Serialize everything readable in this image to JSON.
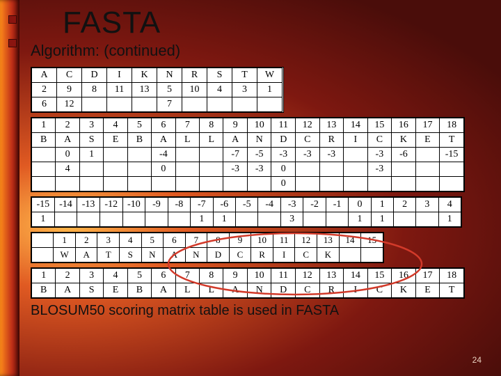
{
  "slide": {
    "title": "FASTA",
    "subtitle": "Algorithm: (continued)",
    "footnote": "BLOSUM50 scoring matrix table is used in FASTA",
    "page_number": "24"
  },
  "tables": {
    "t1": [
      [
        "A",
        "C",
        "D",
        "I",
        "K",
        "N",
        "R",
        "S",
        "T",
        "W"
      ],
      [
        "2",
        "9",
        "8",
        "11",
        "13",
        "5",
        "10",
        "4",
        "3",
        "1"
      ],
      [
        "6",
        "12",
        "",
        "",
        "",
        "7",
        "",
        "",
        "",
        ""
      ]
    ],
    "t2": [
      [
        "1",
        "2",
        "3",
        "4",
        "5",
        "6",
        "7",
        "8",
        "9",
        "10",
        "11",
        "12",
        "13",
        "14",
        "15",
        "16",
        "17",
        "18"
      ],
      [
        "B",
        "A",
        "S",
        "E",
        "B",
        "A",
        "L",
        "L",
        "A",
        "N",
        "D",
        "C",
        "R",
        "I",
        "C",
        "K",
        "E",
        "T"
      ],
      [
        "",
        "0",
        "1",
        "",
        "",
        "-4",
        "",
        "",
        "-7",
        "-5",
        "-3",
        "-3",
        "-3",
        "",
        "-3",
        "-6",
        "",
        "-15"
      ],
      [
        "",
        "4",
        "",
        "",
        "",
        "0",
        "",
        "",
        "-3",
        "-3",
        "0",
        "",
        "",
        "",
        "-3",
        "",
        "",
        ""
      ],
      [
        "",
        "",
        "",
        "",
        "",
        "",
        "",
        "",
        "",
        "",
        "0",
        "",
        "",
        "",
        "",
        "",
        "",
        ""
      ]
    ],
    "t3": [
      [
        "-15",
        "-14",
        "-13",
        "-12",
        "-10",
        "-9",
        "-8",
        "-7",
        "-6",
        "-5",
        "-4",
        "-3",
        "-2",
        "-1",
        "0",
        "1",
        "2",
        "3",
        "4"
      ],
      [
        "1",
        "",
        "",
        "",
        "",
        "",
        "",
        "1",
        "1",
        "",
        "",
        "3",
        "",
        "",
        "1",
        "1",
        "",
        "",
        "1"
      ]
    ],
    "t4": [
      [
        "",
        "1",
        "2",
        "3",
        "4",
        "5",
        "6",
        "7",
        "8",
        "9",
        "10",
        "11",
        "12",
        "13",
        "14",
        "15"
      ],
      [
        "",
        "W",
        "A",
        "T",
        "S",
        "N",
        "A",
        "N",
        "D",
        "C",
        "R",
        "I",
        "C",
        "K",
        "",
        ""
      ]
    ],
    "t5": [
      [
        "1",
        "2",
        "3",
        "4",
        "5",
        "6",
        "7",
        "8",
        "9",
        "10",
        "11",
        "12",
        "13",
        "14",
        "15",
        "16",
        "17",
        "18"
      ],
      [
        "B",
        "A",
        "S",
        "E",
        "B",
        "A",
        "L",
        "L",
        "A",
        "N",
        "D",
        "C",
        "R",
        "I",
        "C",
        "K",
        "E",
        "T"
      ]
    ]
  },
  "annotation": {
    "circle_color": "#d23a2a"
  }
}
